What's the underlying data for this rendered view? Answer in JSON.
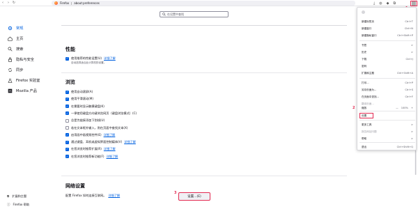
{
  "toolbar": {
    "browser_name": "Firefox",
    "url": "about:preferences"
  },
  "search": {
    "placeholder": "在设置中查找"
  },
  "sidebar": {
    "items": [
      {
        "label": "常规",
        "icon": "gear-icon",
        "active": true
      },
      {
        "label": "主页",
        "icon": "home-icon"
      },
      {
        "label": "搜索",
        "icon": "search-icon"
      },
      {
        "label": "隐私与安全",
        "icon": "lock-icon"
      },
      {
        "label": "同步",
        "icon": "sync-icon"
      },
      {
        "label": "Firefox 实验室",
        "icon": "flask-icon"
      },
      {
        "label": "Mozilla 产品",
        "icon": "mozilla-icon"
      }
    ],
    "bottom": [
      {
        "label": "扩展和主题",
        "icon": "puzzle-icon"
      },
      {
        "label": "Firefox 帮助",
        "icon": "help-icon"
      }
    ]
  },
  "performance": {
    "heading": "性能",
    "use_recommended": "使用推荐的性能设置(U)",
    "use_recommended_link": "详细了解",
    "subtext": "自动选择适合此计算机的设置。"
  },
  "browsing": {
    "heading": "浏览",
    "options": [
      {
        "text": "使用自动滚屏(A)",
        "checked": true
      },
      {
        "text": "使用平滑滚动(M)",
        "checked": true
      },
      {
        "text": "在需要时显示触摸键盘(K)",
        "checked": true
      },
      {
        "text": "一律使用键盘方向键浏览网页（键盘浏览模式）(C)",
        "checked": true
      },
      {
        "text": "总是为链接添加下划线(U)",
        "checked": false
      },
      {
        "text": "若在文本框外输入，则在页面中查找文本(X)",
        "checked": false
      },
      {
        "text": "启用画中画视频控件(E)",
        "checked": true,
        "link": "详细了解"
      },
      {
        "text": "通过键盘、耳机或虚拟界面控制媒体(V)",
        "checked": true,
        "link": "详细了解"
      },
      {
        "text": "在您浏览时推荐扩展(R)",
        "checked": true,
        "link": "详细了解"
      },
      {
        "text": "在您浏览时推荐新功能(F)",
        "checked": true,
        "link": "详细了解"
      }
    ]
  },
  "network": {
    "heading": "网络设置",
    "desc": "配置 Firefox 如何连接互联网。",
    "link": "详细了解",
    "button": "设置...(E)"
  },
  "steps": {
    "one": "1",
    "two": "2",
    "three": "3"
  },
  "menu": {
    "items": [
      {
        "label": "新建标签页",
        "shortcut": "Ctrl+T"
      },
      {
        "label": "新建窗口",
        "shortcut": "Ctrl+N"
      },
      {
        "label": "新建隐私窗口",
        "shortcut": "Ctrl+Shift+P"
      },
      {
        "label": "书签",
        "shortcut": ">"
      },
      {
        "label": "历史",
        "shortcut": ">"
      },
      {
        "label": "下载",
        "shortcut": "Ctrl+J"
      },
      {
        "label": "密码",
        "shortcut": ""
      },
      {
        "label": "扩展和主题",
        "shortcut": "Ctrl+Shift+A"
      },
      {
        "label": "打印...",
        "shortcut": "Ctrl+P"
      },
      {
        "label": "另存页面为...",
        "shortcut": "Ctrl+S"
      },
      {
        "label": "在页面中查找...",
        "shortcut": "Ctrl+F"
      },
      {
        "label": "翻译页面...",
        "shortcut": ""
      },
      {
        "label": "缩放",
        "shortcut": "100%"
      },
      {
        "label": "设置",
        "shortcut": ""
      },
      {
        "label": "更多工具",
        "shortcut": ">"
      },
      {
        "label": "报告网站问题",
        "shortcut": ">"
      },
      {
        "label": "帮助",
        "shortcut": ">"
      },
      {
        "label": "退出",
        "shortcut": "Ctrl+Shift+Q"
      }
    ],
    "zoom_minus": "—",
    "zoom_plus": "+"
  },
  "colors": {
    "accent": "#0061e0",
    "highlight": "#e22850"
  }
}
